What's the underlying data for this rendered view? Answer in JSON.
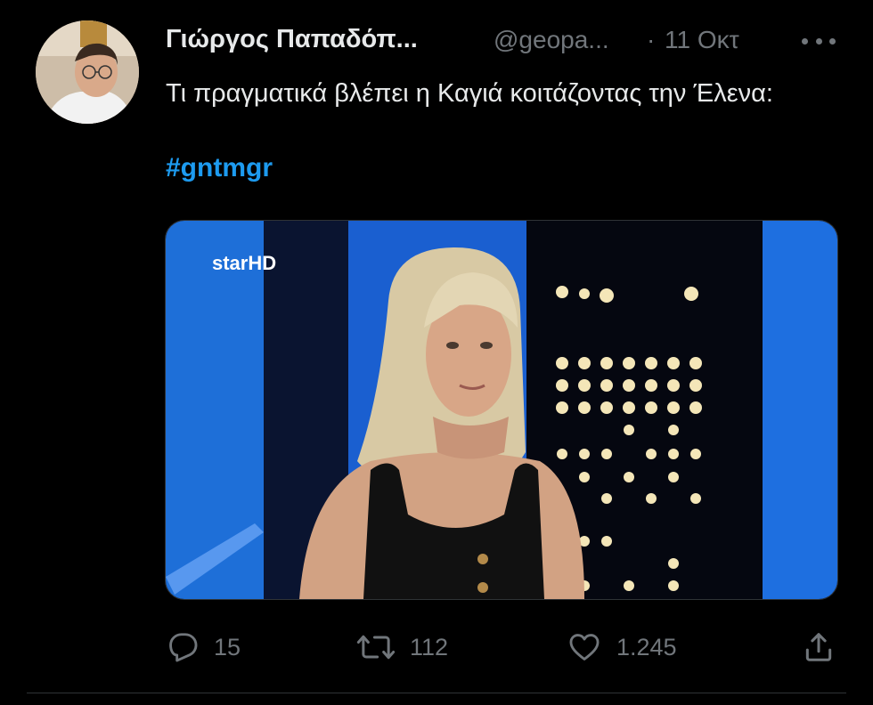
{
  "tweet": {
    "author_name": "Γιώργος Παπαδόπ...",
    "handle": "@geopa...",
    "separator": "·",
    "time": "11 Οκτ",
    "text": "Τι πραγματικά βλέπει η Καγιά κοιτάζοντας την Έλενα:",
    "hashtag": "#gntmgr",
    "media": {
      "logo": "starHD",
      "description": "tv-still-blonde-contestant"
    },
    "actions": {
      "reply": {
        "icon": "reply-icon",
        "count": "15"
      },
      "retweet": {
        "icon": "retweet-icon",
        "count": "112"
      },
      "like": {
        "icon": "heart-icon",
        "count": "1.245"
      },
      "share": {
        "icon": "share-icon"
      }
    }
  },
  "colors": {
    "background": "#000000",
    "text": "#e7e9ea",
    "secondary": "#71767b",
    "accent": "#1d9bf0"
  }
}
